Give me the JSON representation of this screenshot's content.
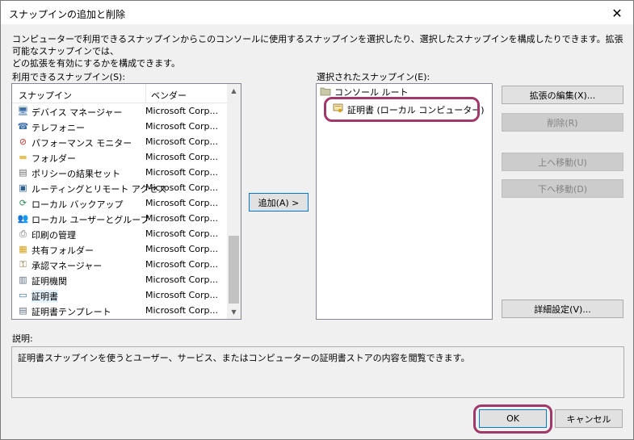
{
  "window": {
    "title": "スナップインの追加と削除",
    "close_glyph": "✕"
  },
  "description_line1": "コンピューターで利用できるスナップインからこのコンソールに使用するスナップインを選択したり、選択したスナップインを構成したりできます。拡張可能なスナップインでは、",
  "description_line2": "どの拡張を有効にするかを構成できます。",
  "available": {
    "label": "利用できるスナップイン(S):",
    "col_snapin": "スナップイン",
    "col_vendor": "ベンダー",
    "items": [
      {
        "name": "デバイス マネージャー",
        "vendor": "Microsoft Corp...",
        "icon": "device-manager-icon",
        "glyph": "🖥",
        "color": "#3a6ea5"
      },
      {
        "name": "テレフォニー",
        "vendor": "Microsoft Corp...",
        "icon": "telephony-icon",
        "glyph": "☎",
        "color": "#3a6ea5"
      },
      {
        "name": "パフォーマンス モニター",
        "vendor": "Microsoft Corp...",
        "icon": "performance-monitor-icon",
        "glyph": "⊘",
        "color": "#c0392b"
      },
      {
        "name": "フォルダー",
        "vendor": "Microsoft Corp...",
        "icon": "folder-icon",
        "glyph": "▬",
        "color": "#e8c15a"
      },
      {
        "name": "ポリシーの結果セット",
        "vendor": "Microsoft Corp...",
        "icon": "policy-result-icon",
        "glyph": "▤",
        "color": "#6d6d6d"
      },
      {
        "name": "ルーティングとリモート アクセス",
        "vendor": "Microsoft Corp...",
        "icon": "routing-icon",
        "glyph": "▣",
        "color": "#2c5f8a"
      },
      {
        "name": "ローカル バックアップ",
        "vendor": "Microsoft Corp...",
        "icon": "backup-icon",
        "glyph": "⟳",
        "color": "#2e8b57"
      },
      {
        "name": "ローカル ユーザーとグループ",
        "vendor": "Microsoft Corp...",
        "icon": "users-groups-icon",
        "glyph": "👥",
        "color": "#3a6ea5"
      },
      {
        "name": "印刷の管理",
        "vendor": "Microsoft Corp...",
        "icon": "print-management-icon",
        "glyph": "⎙",
        "color": "#6d6d6d"
      },
      {
        "name": "共有フォルダー",
        "vendor": "Microsoft Corp...",
        "icon": "shared-folder-icon",
        "glyph": "▦",
        "color": "#d4a017"
      },
      {
        "name": "承認マネージャー",
        "vendor": "Microsoft Corp...",
        "icon": "authorization-manager-icon",
        "glyph": "⚿",
        "color": "#8a6d3b"
      },
      {
        "name": "証明機関",
        "vendor": "Microsoft Corp...",
        "icon": "certification-authority-icon",
        "glyph": "▥",
        "color": "#5d6d7e"
      },
      {
        "name": "証明書",
        "vendor": "Microsoft Corp...",
        "icon": "certificates-icon",
        "glyph": "▭",
        "color": "#3a6ea5"
      },
      {
        "name": "証明書テンプレート",
        "vendor": "Microsoft Corp...",
        "icon": "certificate-templates-icon",
        "glyph": "▤",
        "color": "#5d6d7e"
      }
    ]
  },
  "add_button": "追加(A) >",
  "selected": {
    "label": "選択されたスナップイン(E):",
    "root": "コンソール ルート",
    "child": "証明書 (ローカル コンピューター)"
  },
  "buttons": {
    "edit_extensions": "拡張の編集(X)...",
    "remove": "削除(R)",
    "move_up": "上へ移動(U)",
    "move_down": "下へ移動(D)",
    "advanced": "詳細設定(V)...",
    "ok": "OK",
    "cancel": "キャンセル"
  },
  "explanation": {
    "label": "説明:",
    "text": "証明書スナップインを使うとユーザー、サービス、またはコンピューターの証明書ストアの内容を閲覧できます。"
  },
  "colors": {
    "highlight": "#a0386a",
    "selection": "#e5f3ff",
    "accent": "#0078d7"
  }
}
